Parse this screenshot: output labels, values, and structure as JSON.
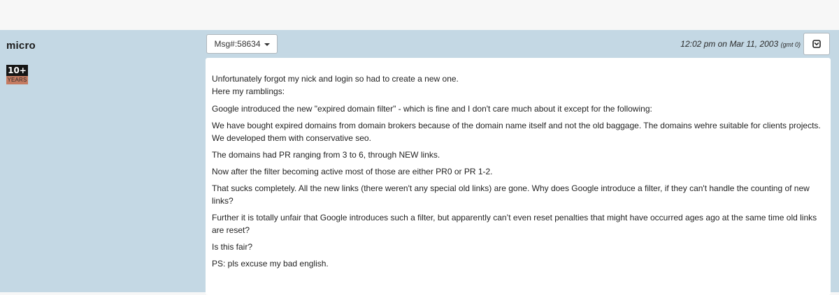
{
  "author": {
    "name": "micro",
    "badge_number": "10+",
    "badge_label": "YEARS"
  },
  "message": {
    "id_label": "Msg#:58634",
    "time": "12:02 pm on Mar 11, 2003",
    "timezone": "(gmt 0)"
  },
  "icons": {
    "caret": "chevron-down-icon",
    "menu": "dropdown-menu-icon"
  },
  "body": {
    "line1": "Unfortunately forgot my nick and login so had to create a new one.",
    "line2": "Here my ramblings:",
    "p1": "Google introduced the new \"expired domain filter\" - which is fine and I don't care much about it except for the following:",
    "p2": "We have bought expired domains from domain brokers because of the domain name itself and not the old baggage. The domains wehre suitable for clients projects. We developed them with conservative seo.",
    "p3": "The domains had PR ranging from 3 to 6, through NEW links.",
    "p4": "Now after the filter becoming active most of those are either PR0 or PR 1-2.",
    "p5": "That sucks completely. All the new links (there weren't any special old links) are gone. Why does Google introduce a filter, if they can't handle the counting of new links?",
    "p6": "Further it is totally unfair that Google introduces such a filter, but apparently can’t even reset penalties that might have occurred ages ago at the same time old links are reset?",
    "p7": "Is this fair?",
    "p8": "PS: pls excuse my bad english."
  },
  "colors": {
    "post_row_bg": "#c4d8e4",
    "badge_top": "#151515",
    "badge_bottom": "#c57b61"
  }
}
